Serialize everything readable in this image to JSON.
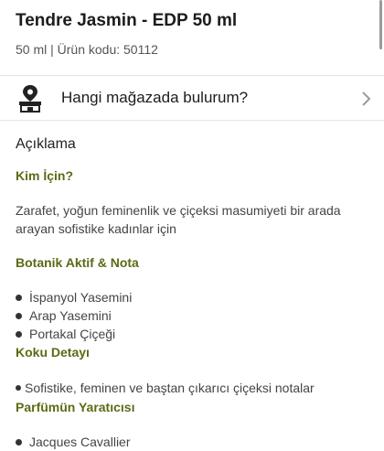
{
  "product": {
    "title": "Tendre Jasmin - EDP 50 ml",
    "subtitle": "50 ml | Ürün kodu: 50112"
  },
  "store_finder": {
    "label": "Hangi mağazada bulurum?",
    "icon": "store-location-icon"
  },
  "description": {
    "section_title": "Açıklama",
    "sections": [
      {
        "heading": "Kim İçin?",
        "text": "Zarafet, yoğun feminenlik ve çiçeksi masumiyeti bir arada arayan sofistike kadınlar için"
      },
      {
        "heading": "Botanik Aktif & Nota",
        "items": [
          "İspanyol Yasemini",
          "Arap Yasemini",
          "Portakal Çiçeği"
        ]
      },
      {
        "heading": "Koku Detayı",
        "text": "Sofistike, feminen ve baştan çıkarıcı çiçeksi notalar"
      },
      {
        "heading": "Parfümün Yaratıcısı",
        "items": [
          "Jacques Cavallier"
        ]
      }
    ]
  },
  "colors": {
    "heading": "#5a6b13",
    "text": "#444444",
    "divider": "#e4e4e4"
  }
}
